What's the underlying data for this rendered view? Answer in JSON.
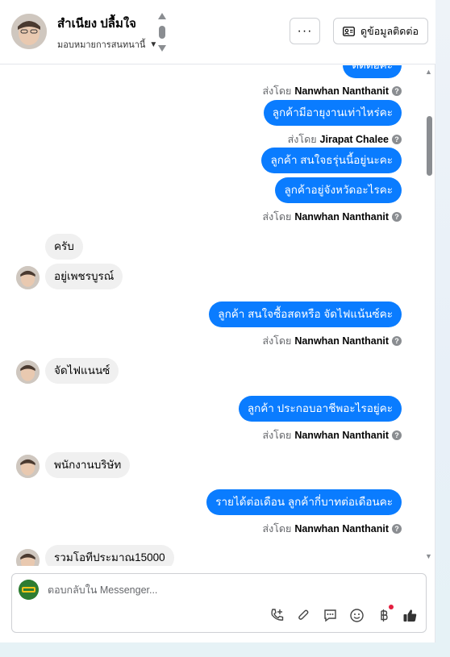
{
  "header": {
    "contact_name": "สำเนียง ปลื้มใจ",
    "assign_label": "มอบหมายการสนทนานี้",
    "more_label": "···",
    "contact_info_label": "ดูข้อมูลติดต่อ"
  },
  "messages": {
    "clipped_top": "ติดต่อค่ะ",
    "sent_by_prefix": "ส่งโดย",
    "m1_sender": "Nanwhan Nanthanit",
    "m2": "ลูกค้ามีอายุงานเท่าไหร่คะ",
    "m2_sender": "Jirapat Chalee",
    "m3": "ลูกค้า สนใจธรุ่นนี้อยู่นะคะ",
    "m4": "ลูกค้าอยู่จังหวัดอะไรคะ",
    "m4_sender": "Nanwhan Nanthanit",
    "r1": "ครับ",
    "r2": "อยู่เพชรบูรณ์",
    "m5": "ลูกค้า สนใจซื้อสดหรือ จัดไฟแน้นซ์คะ",
    "m5_sender": "Nanwhan Nanthanit",
    "r3": "จัดไฟแนนซ์",
    "m6": "ลูกค้า ประกอบอาชีพอะไรอยู่คะ",
    "m6_sender": "Nanwhan Nanthanit",
    "r4": "พนักงานบริษัท",
    "m7": "รายได้ต่อเดือน ลูกค้ากี่บาทต่อเดือนคะ",
    "m7_sender": "Nanwhan Nanthanit",
    "r5": "รวมโอทีประมาณ15000"
  },
  "composer": {
    "placeholder": "ตอบกลับใน Messenger..."
  },
  "icons": {
    "accent": "#0a7cff",
    "tools": [
      "call-add-icon",
      "attach-icon",
      "saved-reply-icon",
      "emoji-icon",
      "baht-icon",
      "like-icon"
    ]
  }
}
